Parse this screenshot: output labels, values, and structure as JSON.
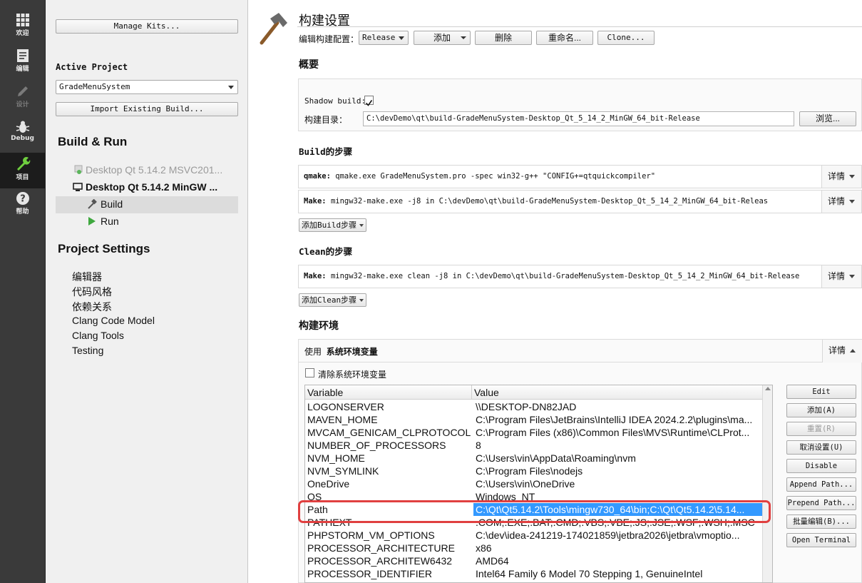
{
  "modebar": {
    "items": [
      {
        "label": "欢迎",
        "icon": "grid-icon"
      },
      {
        "label": "编辑",
        "icon": "document-icon"
      },
      {
        "label": "设计",
        "icon": "pencil-icon"
      },
      {
        "label": "Debug",
        "icon": "bug-icon"
      },
      {
        "label": "项目",
        "icon": "wrench-icon"
      },
      {
        "label": "帮助",
        "icon": "help-icon"
      }
    ]
  },
  "nav": {
    "manage_kits": "Manage Kits...",
    "active_project_label": "Active Project",
    "active_project_value": "GradeMenuSystem",
    "import_build": "Import Existing Build...",
    "build_run_header": "Build & Run",
    "kit_msvc": "Desktop Qt 5.14.2 MSVC201...",
    "kit_mingw": "Desktop Qt 5.14.2 MinGW ...",
    "build": "Build",
    "run": "Run",
    "project_settings_header": "Project Settings",
    "settings": [
      "编辑器",
      "代码风格",
      "依赖关系",
      "Clang Code Model",
      "Clang Tools",
      "Testing"
    ]
  },
  "main": {
    "title": "构建设置",
    "edit_config_label": "编辑构建配置：",
    "config_value": "Release",
    "add": "添加",
    "delete": "删除",
    "rename": "重命名...",
    "clone": "Clone...",
    "overview": "概要",
    "shadow_build_label": "Shadow build:",
    "build_dir_label": "构建目录：",
    "build_dir_value": "C:\\devDemo\\qt\\build-GradeMenuSystem-Desktop_Qt_5_14_2_MinGW_64_bit-Release",
    "browse": "浏览...",
    "build_steps": "Build的步骤",
    "qmake_label": "qmake:",
    "qmake_cmd": "qmake.exe GradeMenuSystem.pro -spec win32-g++ \"CONFIG+=qtquickcompiler\"",
    "make_label": "Make:",
    "make_cmd": "mingw32-make.exe -j8 in C:\\devDemo\\qt\\build-GradeMenuSystem-Desktop_Qt_5_14_2_MinGW_64_bit-Releas",
    "details": "详情",
    "add_build_step": "添加Build步骤",
    "clean_steps": "Clean的步骤",
    "clean_make_cmd": "mingw32-make.exe clean -j8 in C:\\devDemo\\qt\\build-GradeMenuSystem-Desktop_Qt_5_14_2_MinGW_64_bit-Release",
    "add_clean_step": "添加Clean步骤",
    "build_env": "构建环境",
    "use_label": "使用",
    "use_value": "系统环境变量",
    "clear_env_label": "清除系统环境变量"
  },
  "env_table": {
    "headers": [
      "Variable",
      "Value"
    ],
    "rows": [
      {
        "var": "LOGONSERVER",
        "val": "\\\\DESKTOP-DN82JAD"
      },
      {
        "var": "MAVEN_HOME",
        "val": "C:\\Program Files\\JetBrains\\IntelliJ IDEA 2024.2.2\\plugins\\ma..."
      },
      {
        "var": "MVCAM_GENICAM_CLPROTOCOL",
        "val": "C:\\Program Files (x86)\\Common Files\\MVS\\Runtime\\CLProt..."
      },
      {
        "var": "NUMBER_OF_PROCESSORS",
        "val": "8"
      },
      {
        "var": "NVM_HOME",
        "val": "C:\\Users\\vin\\AppData\\Roaming\\nvm"
      },
      {
        "var": "NVM_SYMLINK",
        "val": "C:\\Program Files\\nodejs"
      },
      {
        "var": "OneDrive",
        "val": "C:\\Users\\vin\\OneDrive"
      },
      {
        "var": "OS",
        "val": "Windows_NT"
      },
      {
        "var": "Path",
        "val": "C:\\Qt\\Qt5.14.2\\Tools\\mingw730_64\\bin;C:\\Qt\\Qt5.14.2\\5.14..."
      },
      {
        "var": "PATHEXT",
        "val": ".COM;.EXE;.BAT;.CMD;.VBS;.VBE;.JS;.JSE;.WSF;.WSH;.MSC"
      },
      {
        "var": "PHPSTORM_VM_OPTIONS",
        "val": "C:\\dev\\idea-241219-174021859\\jetbra2026\\jetbra\\vmoptio..."
      },
      {
        "var": "PROCESSOR_ARCHITECTURE",
        "val": "x86"
      },
      {
        "var": "PROCESSOR_ARCHITEW6432",
        "val": "AMD64"
      },
      {
        "var": "PROCESSOR_IDENTIFIER",
        "val": "Intel64 Family 6 Model 70 Stepping 1, GenuineIntel"
      }
    ],
    "selected_row": 8
  },
  "env_buttons": [
    "Edit",
    "添加(A)",
    "重置(R)",
    "取消设置(U)",
    "Disable",
    "Append Path...",
    "Prepend Path...",
    "批量编辑(B)...",
    "Open Terminal"
  ],
  "colors": {
    "selection": "#3399ff",
    "highlight": "#e04040",
    "modebar": "#3a3a3a"
  }
}
